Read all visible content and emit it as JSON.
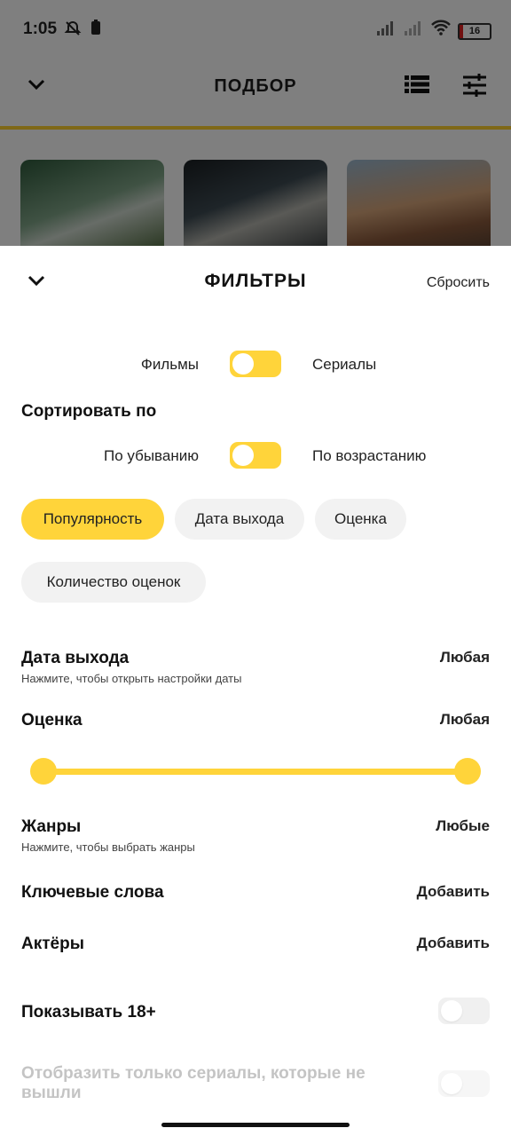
{
  "status": {
    "time": "1:05",
    "battery": "16",
    "icons": [
      "alarm-off-icon",
      "battery-small-icon",
      "signal-icon",
      "signal-weak-icon",
      "wifi-icon"
    ]
  },
  "background": {
    "title": "ПОДБОР"
  },
  "sheet": {
    "title": "ФИЛЬТРЫ",
    "reset_label": "Сбросить",
    "type_toggle": {
      "left": "Фильмы",
      "right": "Сериалы"
    },
    "sort_title": "Сортировать по",
    "order_toggle": {
      "left": "По убыванию",
      "right": "По возрастанию"
    },
    "sort_chips": [
      "Популярность",
      "Дата выхода",
      "Оценка",
      "Количество оценок"
    ],
    "release": {
      "title": "Дата выхода",
      "subtitle": "Нажмите, чтобы открыть настройки даты",
      "value": "Любая"
    },
    "rating": {
      "title": "Оценка",
      "value": "Любая"
    },
    "genres": {
      "title": "Жанры",
      "subtitle": "Нажмите, чтобы выбрать жанры",
      "value": "Любые"
    },
    "keywords": {
      "title": "Ключевые слова",
      "value": "Добавить"
    },
    "actors": {
      "title": "Актёры",
      "value": "Добавить"
    },
    "adult": {
      "title": "Показывать 18+"
    },
    "unreleased": {
      "title": "Отобразить только сериалы, которые не вышли"
    }
  }
}
